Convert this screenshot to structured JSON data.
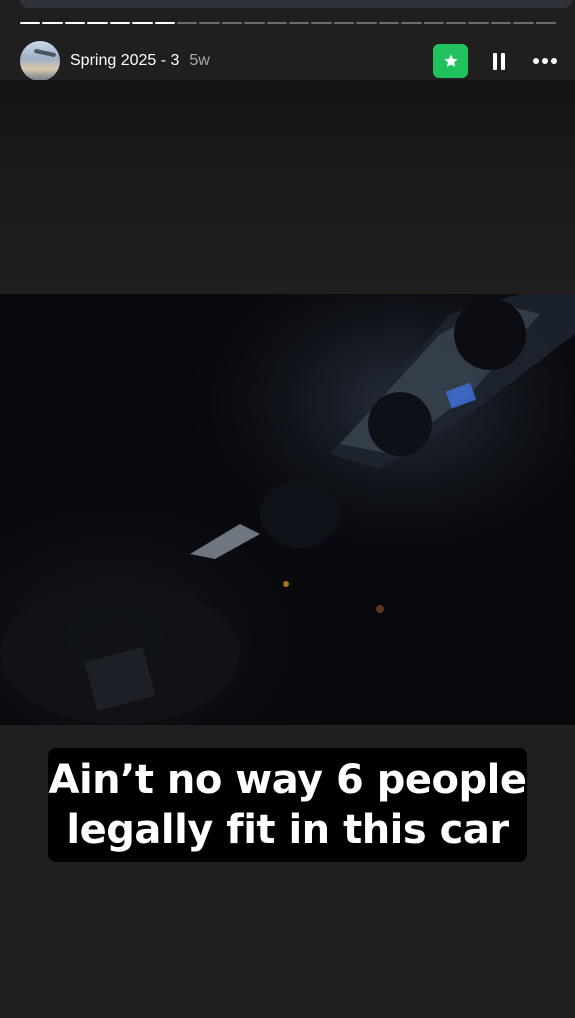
{
  "story": {
    "title": "Spring 2025 - 3",
    "age": "5w",
    "segments_total": 24,
    "segments_done": 7
  },
  "controls": {
    "favorite_icon": "star-icon",
    "pause_icon": "pause-icon",
    "more_icon": "more-horizontal-icon"
  },
  "caption": {
    "line1": "Ain’t no way 6 people",
    "line2": "legally fit in this car"
  },
  "colors": {
    "favorite_bg": "#21c25e",
    "background": "#1f1f1f"
  }
}
